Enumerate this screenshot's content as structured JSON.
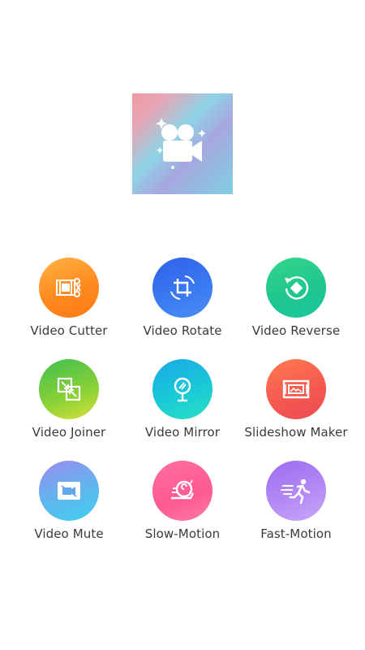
{
  "app": {
    "logo_icon": "video-camera-sparkle-icon"
  },
  "tools": [
    {
      "label": "Video Cutter",
      "icon": "film-scissors-icon",
      "color": "#ff8a1e"
    },
    {
      "label": "Video Rotate",
      "icon": "crop-rotate-icon",
      "color": "#3b7bf2"
    },
    {
      "label": "Video Reverse",
      "icon": "rotate-reverse-icon",
      "color": "#1ec58f"
    },
    {
      "label": "Video Joiner",
      "icon": "merge-squares-icon",
      "color": "#8bd136"
    },
    {
      "label": "Video Mirror",
      "icon": "mirror-icon",
      "color": "#19c9d6"
    },
    {
      "label": "Slideshow Maker",
      "icon": "slideshow-icon",
      "color": "#f4574f"
    },
    {
      "label": "Video Mute",
      "icon": "camera-mute-icon",
      "color": "#5fb6ee"
    },
    {
      "label": "Slow-Motion",
      "icon": "snail-icon",
      "color": "#ff5a8f"
    },
    {
      "label": "Fast-Motion",
      "icon": "running-man-icon",
      "color": "#b58cf5"
    }
  ]
}
